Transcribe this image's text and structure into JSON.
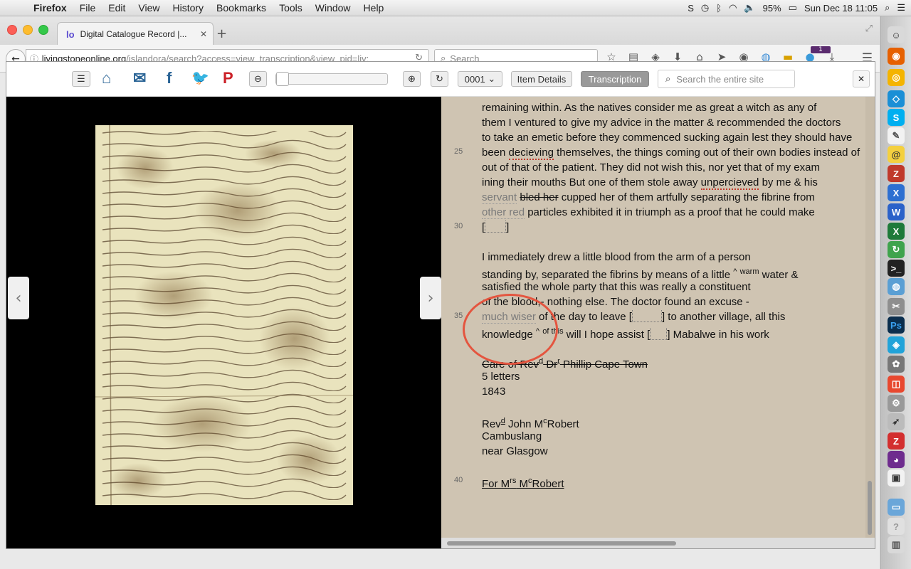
{
  "menubar": {
    "app": "Firefox",
    "items": [
      "File",
      "Edit",
      "View",
      "History",
      "Bookmarks",
      "Tools",
      "Window",
      "Help"
    ],
    "battery": "95%",
    "clock": "Sun Dec 18  11:05"
  },
  "browser": {
    "tab_title": "Digital Catalogue Record |...",
    "url_host": "livingstoneonline.org",
    "url_path": "/islandora/search?access=view_transcription&view_pid=liv:",
    "search_placeholder": "Search",
    "notification_count": "1"
  },
  "toolbar": {
    "page_select": "0001",
    "item_details": "Item Details",
    "transcription": "Transcription",
    "site_search_placeholder": "Search the entire site"
  },
  "transcript": {
    "l1": "remaining within. As the natives consider me as great a witch as any of",
    "l2": "them I ventured to give my advice in the matter & recommended the doctors",
    "l3": "to take an emetic before they commenced sucking again lest they should have",
    "l4_a": "been ",
    "l4_sic": "decieving",
    "l4_b": " themselves, the things coming out of their own bodies instead of",
    "l5": "out of that of the patient. They did not wish this, nor yet that of my exam",
    "l6_a": "ining their mouths But one of them stole away ",
    "l6_sic": "unpercieved",
    "l6_b": " by me & his",
    "l7_gray": "servant",
    "l7_strike": "bled her",
    "l7_b": " cupped her of them artfully separating the fibrine from",
    "l8_gray": "other red",
    "l8_b": " particles exhibited it in triumph as a proof that he could make",
    "l10": "I immediately drew a little blood from the arm of a person",
    "l11_a": "standing by, separated the fibrins by means of a little ",
    "l11_caret": "^",
    "l11_sup": "warm",
    "l11_b": " water &",
    "l12": "satisfied the whole party that this was really a constituent",
    "l13": "of the blood,- nothing else. The doctor found an excuse -",
    "l14_gray": "much wiser",
    "l14_a": " of the day to leave ",
    "l14_b": " to another village, all this",
    "l15_a": "knowledge ",
    "l15_caret": "^",
    "l15_sup": "of this",
    "l15_b": " will I hope assist ",
    "l15_c": " Mabalwe in his work",
    "addr_strike_a": "Care of Rev",
    "addr_sup1": "d",
    "addr_strike_b": " Dr",
    "addr_sup2": "r",
    "addr_strike_c": " Phillip Cape Town",
    "addr2": "5 letters",
    "addr3": "1843",
    "addr4_a": "Rev",
    "addr4_sup": "d",
    "addr4_b": " John M",
    "addr4_sup2": "c",
    "addr4_c": "Robert",
    "addr5": "Cambuslang",
    "addr6": "near Glasgow",
    "addr7_a": "For M",
    "addr7_sup": "rs",
    "addr7_b": " M",
    "addr7_sup2": "c",
    "addr7_c": "Robert",
    "ln25": "25",
    "ln30": "30",
    "ln35": "35",
    "ln40": "40"
  },
  "colors": {
    "transcript_bg": "#cfc4b2",
    "annotation_circle": "#e4553f",
    "link_blue": "#2a6496"
  }
}
